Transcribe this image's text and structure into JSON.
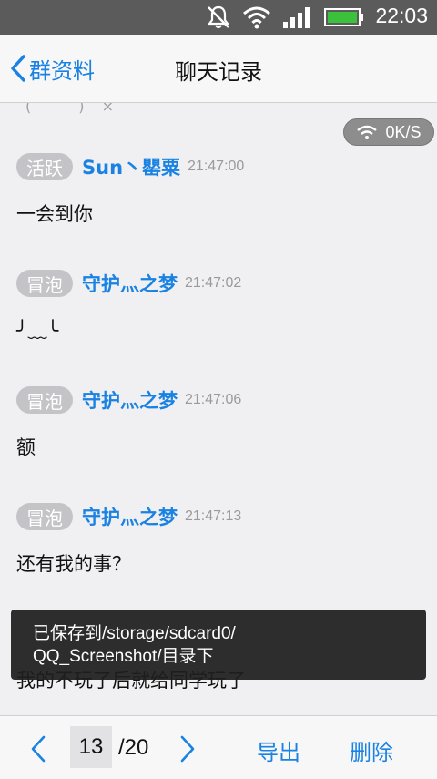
{
  "status_bar": {
    "time": "22:03",
    "icons": [
      "mute-icon",
      "wifi-icon",
      "signal-icon",
      "battery-icon"
    ]
  },
  "nav": {
    "back_label": "群资料",
    "title": "聊天记录"
  },
  "network_speed": "0K/S",
  "messages": [
    {
      "badge": "活跃",
      "sender": "Sun丶罌粟",
      "time": "21:47:00",
      "text": "一会到你"
    },
    {
      "badge": "冒泡",
      "sender": "守护灬之梦",
      "time": "21:47:02",
      "text": "╯﹏╰"
    },
    {
      "badge": "冒泡",
      "sender": "守护灬之梦",
      "time": "21:47:06",
      "text": "额"
    },
    {
      "badge": "冒泡",
      "sender": "守护灬之梦",
      "time": "21:47:13",
      "text": "还有我的事？"
    },
    {
      "text": "我的不玩了后就给同学玩了"
    }
  ],
  "toast": {
    "line1": "已保存到/storage/sdcard0/",
    "line2": "QQ_Screenshot/目录下"
  },
  "pager": {
    "current": "13",
    "total": "/20",
    "export_label": "导出",
    "delete_label": "删除"
  },
  "colors": {
    "accent": "#1a82e2",
    "badge_bg": "#c4c4c8",
    "status_bar_bg": "#5b5b5b"
  }
}
